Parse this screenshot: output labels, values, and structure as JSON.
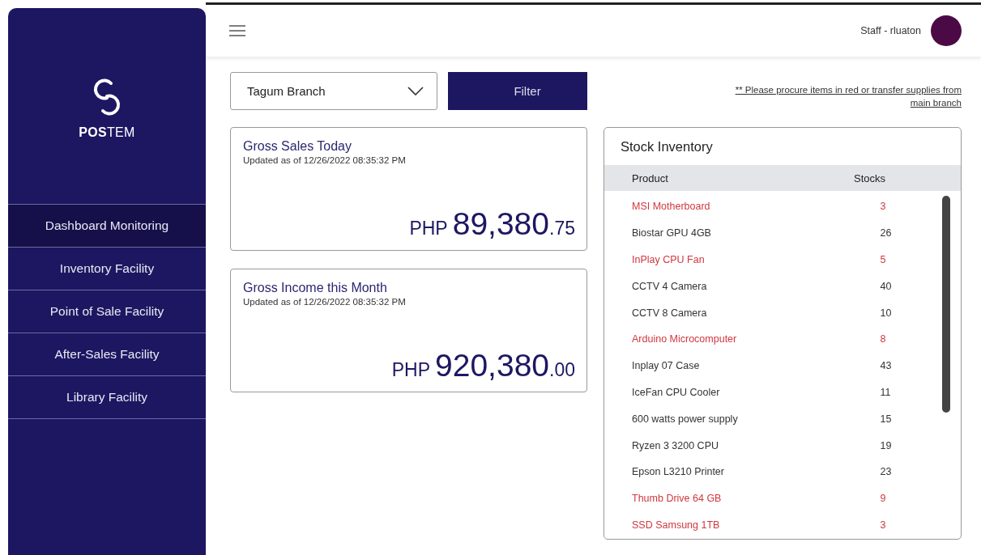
{
  "sidebar": {
    "brand": "**POS**TEM",
    "items": [
      {
        "label": "Dashboard Monitoring",
        "selected": true
      },
      {
        "label": "Inventory Facility",
        "selected": false
      },
      {
        "label": "Point of Sale Facility",
        "selected": false
      },
      {
        "label": "After-Sales Facility",
        "selected": false
      },
      {
        "label": "Library Facility",
        "selected": false
      }
    ]
  },
  "header": {
    "user": "Staff - rluaton"
  },
  "branch_select": {
    "value": "Tagum Branch"
  },
  "filter_button": "Filter",
  "note": "** Please procure items in red or transfer supplies from main branch",
  "cards": [
    {
      "title": "Gross Sales Today",
      "updated": "Updated as of 12/26/2022 08:35:32 PM",
      "currency": "PHP",
      "whole": "89,380",
      "cents": ".75"
    },
    {
      "title": "Gross Income this Month",
      "updated": "Updated as of 12/26/2022 08:35:32 PM",
      "currency": "PHP",
      "whole": "920,380",
      "cents": ".00"
    }
  ],
  "stock_inventory": {
    "title": "Stock Inventory",
    "columns": [
      "Product",
      "Stocks"
    ],
    "rows": [
      {
        "product": "MSI Motherboard",
        "stocks": "3",
        "low": true
      },
      {
        "product": "Biostar GPU 4GB",
        "stocks": "26",
        "low": false
      },
      {
        "product": "InPlay CPU Fan",
        "stocks": "5",
        "low": true
      },
      {
        "product": "CCTV 4 Camera",
        "stocks": "40",
        "low": false
      },
      {
        "product": "CCTV 8 Camera",
        "stocks": "10",
        "low": false
      },
      {
        "product": "Arduino Microcomputer",
        "stocks": "8",
        "low": true
      },
      {
        "product": "Inplay 07 Case",
        "stocks": "43",
        "low": false
      },
      {
        "product": "IceFan CPU Cooler",
        "stocks": "11",
        "low": false
      },
      {
        "product": "600 watts power supply",
        "stocks": "15",
        "low": false
      },
      {
        "product": "Ryzen 3 3200 CPU",
        "stocks": "19",
        "low": false
      },
      {
        "product": "Epson L3210 Printer",
        "stocks": "23",
        "low": false
      },
      {
        "product": "Thumb Drive 64 GB",
        "stocks": "9",
        "low": true
      },
      {
        "product": "SSD Samsung 1TB",
        "stocks": "3",
        "low": true
      }
    ]
  }
}
